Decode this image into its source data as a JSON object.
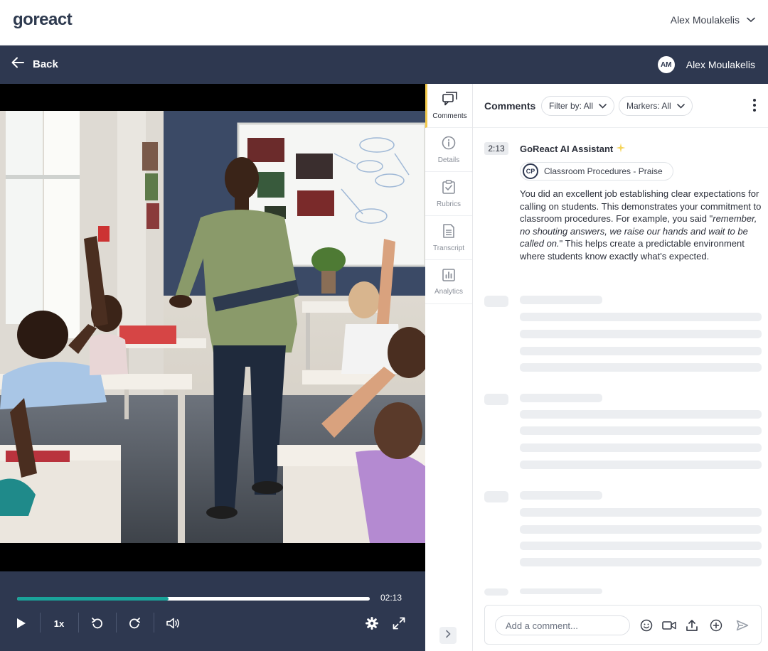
{
  "app": {
    "logo_text": "goreact",
    "user_name": "Alex Moulakelis"
  },
  "navbar": {
    "back_label": "Back",
    "avatar_initials": "AM",
    "user_name": "Alex Moulakelis"
  },
  "player": {
    "current_time": "02:13",
    "progress_fraction": 0.43,
    "speed_label": "1x",
    "icons": [
      "play-icon",
      "rewind-icon",
      "forward-icon",
      "volume-icon",
      "settings-icon",
      "fullscreen-icon"
    ]
  },
  "side_tabs": [
    {
      "label": "Comments",
      "icon": "comments-icon",
      "active": true
    },
    {
      "label": "Details",
      "icon": "info-icon",
      "active": false
    },
    {
      "label": "Rubrics",
      "icon": "rubric-clipboard-icon",
      "active": false
    },
    {
      "label": "Transcript",
      "icon": "document-icon",
      "active": false
    },
    {
      "label": "Analytics",
      "icon": "chart-icon",
      "active": false
    }
  ],
  "comments_panel": {
    "title": "Comments",
    "filter_label": "Filter by: All",
    "markers_label": "Markers: All"
  },
  "comment": {
    "timestamp": "2:13",
    "author": "GoReact AI Assistant",
    "tag_initials": "CP",
    "tag_label": "Classroom Procedures - Praise",
    "text_before": "You did an excellent job establishing clear expectations for calling on students. This demonstrates your commitment to classroom procedures. For example, you said \"",
    "text_quote": "remember, no shouting answers, we raise our hands and wait to be called on.",
    "text_after": "\" This helps create a predictable environment where students know exactly what's expected."
  },
  "composer": {
    "placeholder": "Add a comment..."
  },
  "colors": {
    "navy": "#2e3850",
    "teal": "#1aa39a",
    "active_tab_accent": "#f2c94c"
  }
}
